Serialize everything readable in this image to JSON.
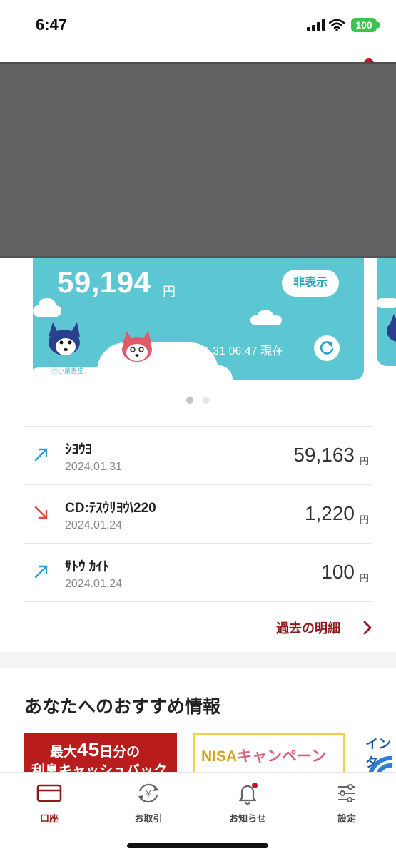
{
  "status_bar": {
    "time": "6:47",
    "battery": "100"
  },
  "card": {
    "balance": "59,194",
    "unit": "円",
    "hide_label": "非表示",
    "as_of": "2024.01.31 06:47 現在",
    "copyright": "Ⓒ小泉善堂"
  },
  "transactions": [
    {
      "name": "ｼﾖｳﾖ",
      "date": "2024.01.31",
      "amount": "59,163",
      "yen": "円",
      "direction": "in"
    },
    {
      "name": "CD:ﾃｽｳﾘﾖｳ\\220",
      "date": "2024.01.24",
      "amount": "1,220",
      "yen": "円",
      "direction": "out"
    },
    {
      "name": "ｻﾄｳ ｶｲﾄ",
      "date": "2024.01.24",
      "amount": "100",
      "yen": "円",
      "direction": "in"
    }
  ],
  "history_link": "過去の明細",
  "recommend": {
    "title": "あなたへのおすすめ情報",
    "banners": [
      {
        "line1_prefix": "最大",
        "line1_number": "45",
        "line1_suffix": "日分の",
        "line2": "利息キャッシュバック"
      },
      {
        "text_prefix": "NISA",
        "text_suffix": "キャンペーン"
      },
      {
        "text": "インタ"
      }
    ]
  },
  "tabs": [
    {
      "label": "口座",
      "icon": "card-icon",
      "active": true
    },
    {
      "label": "お取引",
      "icon": "yen-exchange-icon",
      "active": false
    },
    {
      "label": "お知らせ",
      "icon": "bell-icon",
      "active": false
    },
    {
      "label": "設定",
      "icon": "sliders-icon",
      "active": false
    }
  ],
  "colors": {
    "accent": "#8b1a1a",
    "card": "#5dc6d3",
    "in_arrow": "#2a9fd6",
    "out_arrow": "#e0453a"
  }
}
